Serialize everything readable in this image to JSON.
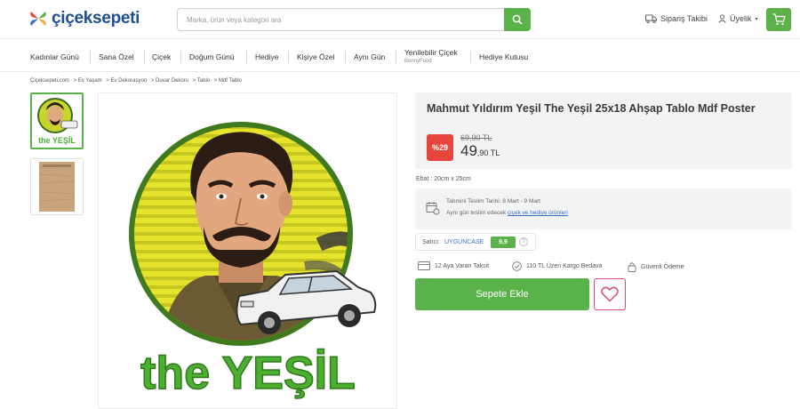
{
  "header": {
    "logo_text": "çiçeksepeti",
    "search_placeholder": "Marka, ürün veya kategori ara",
    "order_tracking": "Sipariş Takibi",
    "account": "Üyelik"
  },
  "categories": [
    {
      "label": "Kadınlar Günü"
    },
    {
      "label": "Sana Özel"
    },
    {
      "label": "Çiçek"
    },
    {
      "label": "Doğum Günü"
    },
    {
      "label": "Hediye"
    },
    {
      "label": "Kişiye Özel"
    },
    {
      "label": "Aynı Gün"
    },
    {
      "label": "Yenilebilir Çiçek",
      "sub": "BonnyFood"
    },
    {
      "label": "Hediye Kutusu"
    }
  ],
  "breadcrumb": [
    "Çiçeksepeti.com",
    "> Ev Yaşam",
    "> Ev Dekorasyon",
    "> Duvar Dekoru",
    "> Tablo",
    "> Mdf Tablo"
  ],
  "product": {
    "title": "Mahmut Yıldırım Yeşil The Yeşil 25x18 Ahşap Tablo Mdf Poster",
    "discount": "%29",
    "old_price": "69,90 TL",
    "price_int": "49",
    "price_dec": ",90 TL",
    "size": "Ebat : 20cm x 25cm",
    "artwork_caption": "the YEŞİL"
  },
  "delivery": {
    "line1": "Tahmini Teslim Tarihi: 8 Mart - 9 Mart",
    "line2_prefix": "Aynı gün teslim edecek ",
    "line2_link": "çiçek ve hediye ürünleri"
  },
  "seller": {
    "label": "Satıcı:",
    "name": "UYGUNCASE",
    "score": "9,9",
    "info_symbol": "?"
  },
  "features": [
    {
      "text": "12 Aya Varan Taksit",
      "icon": "card-icon"
    },
    {
      "text": "110 TL Üzeri Kargo Bedava",
      "icon": "check-circle-icon"
    },
    {
      "text": "Güvenli Ödeme",
      "icon": "lock-icon"
    }
  ],
  "actions": {
    "add_to_cart": "Sepete Ekle"
  },
  "colors": {
    "brand_green": "#5bb14a",
    "brand_blue": "#1d4f8f",
    "discount_red": "#e8453c",
    "favorite_pink": "#d84a6a"
  }
}
